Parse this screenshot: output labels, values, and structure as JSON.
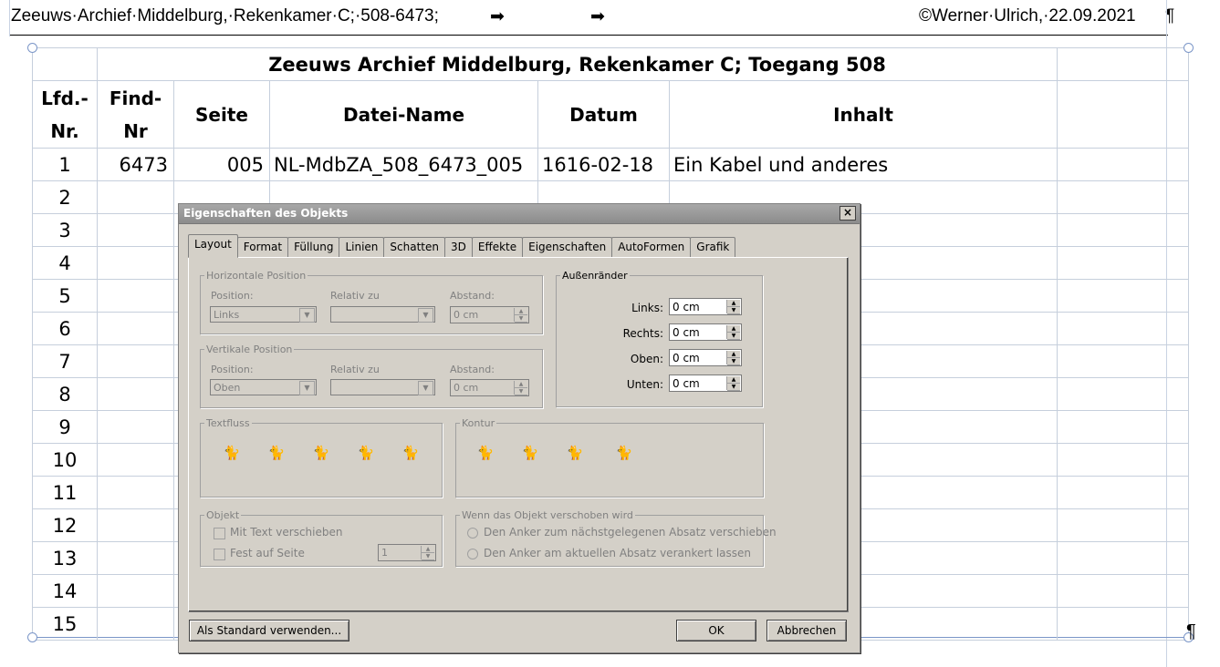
{
  "header": {
    "left": "Zeeuws·Archief·Middelburg,·Rekenkamer·C;·508-6473;",
    "arrow1": "➡",
    "arrow2": "➡",
    "right": "©Werner·Ulrich,·22.09.2021",
    "pilcrow": "¶"
  },
  "end_pilcrow": "¶",
  "table": {
    "title": "Zeeuws Archief Middelburg, Rekenkamer C; Toegang 508",
    "col_lfd_1": "Lfd.-",
    "col_lfd_2": "Nr.",
    "col_find_1": "Find-",
    "col_find_2": "Nr",
    "col_seite": "Seite",
    "col_datei": "Datei-Name",
    "col_datum": "Datum",
    "col_inhalt": "Inhalt",
    "row1": {
      "lfd": "1",
      "find": "6473",
      "seite": "005",
      "datei": "NL-MdbZA_508_6473_005",
      "datum": "1616-02-18",
      "inhalt": "Ein Kabel und anderes"
    },
    "row_numbers": [
      "2",
      "3",
      "4",
      "5",
      "6",
      "7",
      "8",
      "9",
      "10",
      "11",
      "12",
      "13",
      "14",
      "15"
    ]
  },
  "dialog": {
    "title": "Eigenschaften des Objekts",
    "close": "×",
    "tabs": [
      "Layout",
      "Format",
      "Füllung",
      "Linien",
      "Schatten",
      "3D",
      "Effekte",
      "Eigenschaften",
      "AutoFormen",
      "Grafik"
    ],
    "horizontal": {
      "legend": "Horizontale Position",
      "position_label": "Position:",
      "position_value": "Links",
      "relativ_label": "Relativ zu",
      "abstand_label": "Abstand:",
      "abstand_value": "0 cm"
    },
    "vertical": {
      "legend": "Vertikale Position",
      "position_label": "Position:",
      "position_value": "Oben",
      "relativ_label": "Relativ zu",
      "abstand_label": "Abstand:",
      "abstand_value": "0 cm"
    },
    "margins": {
      "legend": "Außenränder",
      "links_label": "Links:",
      "links_value": "0 cm",
      "rechts_label": "Rechts:",
      "rechts_value": "0 cm",
      "oben_label": "Oben:",
      "oben_value": "0 cm",
      "unten_label": "Unten:",
      "unten_value": "0 cm"
    },
    "textfluss": {
      "legend": "Textfluss"
    },
    "kontur": {
      "legend": "Kontur"
    },
    "objekt": {
      "legend": "Objekt",
      "mit_text": "Mit Text verschieben",
      "fest": "Fest auf Seite",
      "page_value": "1"
    },
    "move": {
      "legend": "Wenn das Objekt verschoben wird",
      "opt1": "Den Anker zum nächstgelegenen Absatz verschieben",
      "opt2": "Den Anker am aktuellen Absatz verankert lassen"
    },
    "buttons": {
      "standard": "Als Standard verwenden...",
      "ok": "OK",
      "cancel": "Abbrechen"
    }
  }
}
